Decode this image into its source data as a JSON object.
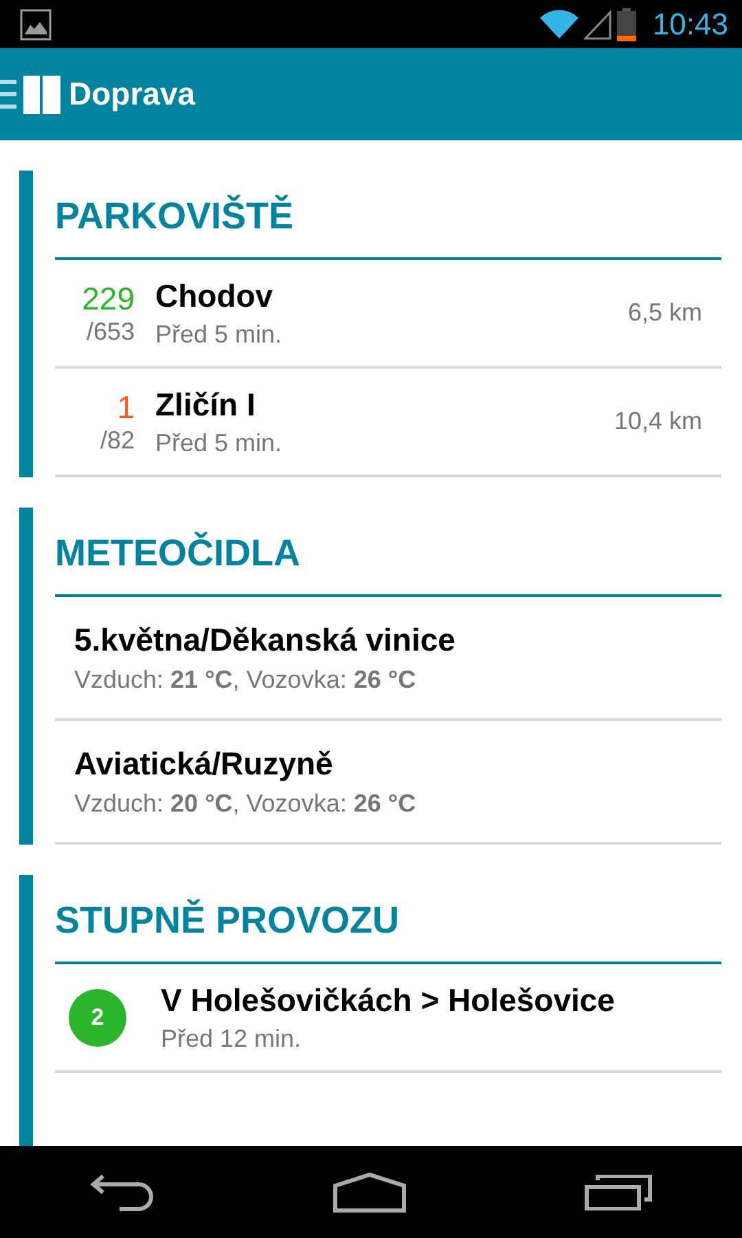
{
  "status_bar": {
    "time": "10:43"
  },
  "app_bar": {
    "title": "Doprava"
  },
  "sections": [
    {
      "kind": "parking",
      "title": "PARKOVIŠTĚ",
      "items": [
        {
          "free": "229",
          "color": "#2bb52b",
          "capacity": "/653",
          "name": "Chodov",
          "updated": "Před 5 min.",
          "distance": "6,5 km"
        },
        {
          "free": "1",
          "color": "#ff5a1e",
          "capacity": "/82",
          "name": "Zličín I",
          "updated": "Před 5 min.",
          "distance": "10,4 km"
        }
      ]
    },
    {
      "kind": "weather",
      "title": "METEOČIDLA",
      "items": [
        {
          "name": "5.května/Děkanská vinice",
          "reading": "Vzduch: **21 °C**, Vozovka: **26 °C**"
        },
        {
          "name": "Aviatická/Ruzyně",
          "reading": "Vzduch: **20 °C**, Vozovka: **26 °C**"
        }
      ]
    },
    {
      "kind": "traffic",
      "title": "STUPNĚ PROVOZU",
      "items": [
        {
          "level_label": "2",
          "color": "#2bb52b",
          "name": "V Holešovičkách > Holešovice",
          "updated": "Před 12 min."
        }
      ]
    }
  ]
}
